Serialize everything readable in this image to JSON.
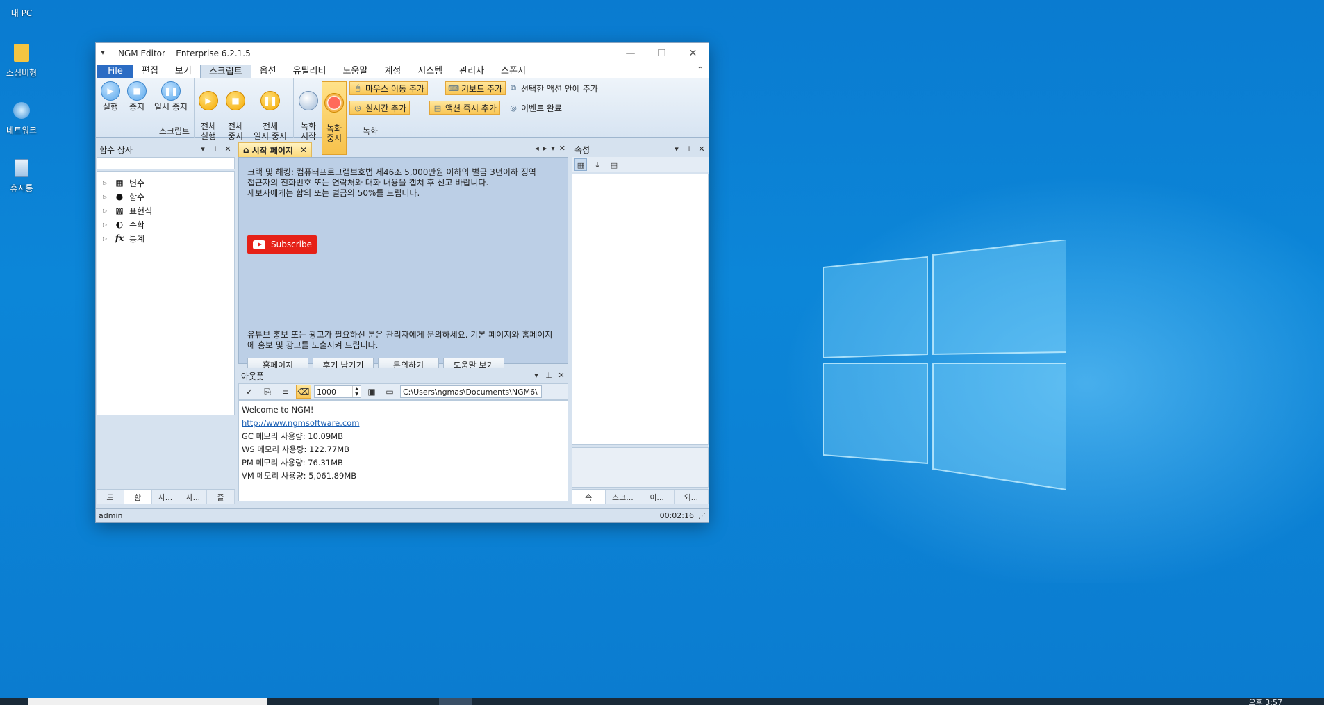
{
  "desktop": {
    "icons": [
      {
        "label": "내 PC",
        "icon": "pc-icon"
      },
      {
        "label": "소심비형",
        "icon": "user-folder-icon"
      },
      {
        "label": "네트워크",
        "icon": "network-icon"
      },
      {
        "label": "휴지통",
        "icon": "recycle-bin-icon"
      }
    ],
    "clock": "오후 3:57"
  },
  "window": {
    "app_name": "NGM Editor",
    "edition": "Enterprise 6.2.1.5",
    "menu": [
      "File",
      "편집",
      "보기",
      "스크립트",
      "옵션",
      "유틸리티",
      "도움말",
      "계정",
      "시스템",
      "관리자",
      "스폰서"
    ],
    "active_menu": "스크립트"
  },
  "ribbon": {
    "script_group": {
      "label": "스크립트",
      "buttons": [
        {
          "label": "실행"
        },
        {
          "label": "중지"
        },
        {
          "label": "일시 중지"
        },
        {
          "label": "전체\n실행"
        },
        {
          "label": "전체\n중지"
        },
        {
          "label": "전체\n일시 중지"
        }
      ]
    },
    "record_group": {
      "label": "녹화",
      "record_start": "녹화\n시작",
      "record_stop": "녹화\n중지",
      "mouse_move": "마우스 이동 추가",
      "keyboard": "키보드 추가",
      "add_in_selected": "선택한 액션 안에 추가",
      "realtime": "실시간 추가",
      "add_action_now": "액션 즉시 추가",
      "event_done": "이벤트 완료"
    }
  },
  "left_pane": {
    "title": "함수 상자",
    "tree": [
      {
        "label": "변수",
        "icon": "variable-icon"
      },
      {
        "label": "함수",
        "icon": "function-icon"
      },
      {
        "label": "표현식",
        "icon": "expression-icon"
      },
      {
        "label": "수학",
        "icon": "math-icon"
      },
      {
        "label": "통계",
        "icon": "fx-icon"
      }
    ],
    "tabs": [
      "도",
      "함",
      "사...",
      "사...",
      "즐"
    ]
  },
  "start_page": {
    "tab_label": "시작 페이지",
    "notice_line1": "크랙 및 해킹: 컴퓨터프로그램보호법 제46조 5,000만원 이하의 벌금 3년이하 징역",
    "notice_line2": "접근자의 전화번호 또는 연락처와 대화 내용을 캡쳐 후 신고 바랍니다.",
    "notice_line3": "제보자에게는 합의 또는 벌금의 50%를 드립니다.",
    "subscribe": "Subscribe",
    "promo": "유튜브 홍보 또는 광고가 필요하신 분은 관리자에게 문의하세요. 기본 페이지와 홈페이지에 홍보 및 광고를 노출시켜 드립니다.",
    "buttons": [
      "홈페이지",
      "후기 남기기",
      "문의하기",
      "도움말 보기"
    ]
  },
  "output": {
    "title": "아웃풋",
    "max_lines": "1000",
    "path": "C:\\Users\\ngmas\\Documents\\NGM6\\",
    "lines": [
      "Welcome to NGM!",
      "http://www.ngmsoftware.com",
      "GC 메모리 사용량: 10.09MB",
      "WS 메모리 사용량: 122.77MB",
      "PM 메모리 사용량: 76.31MB",
      "VM 메모리 사용량: 5,061.89MB"
    ]
  },
  "right_pane": {
    "title": "속성",
    "tabs": [
      "속",
      "스크...",
      "이...",
      "외..."
    ]
  },
  "status": {
    "user": "admin",
    "time": "00:02:16"
  }
}
